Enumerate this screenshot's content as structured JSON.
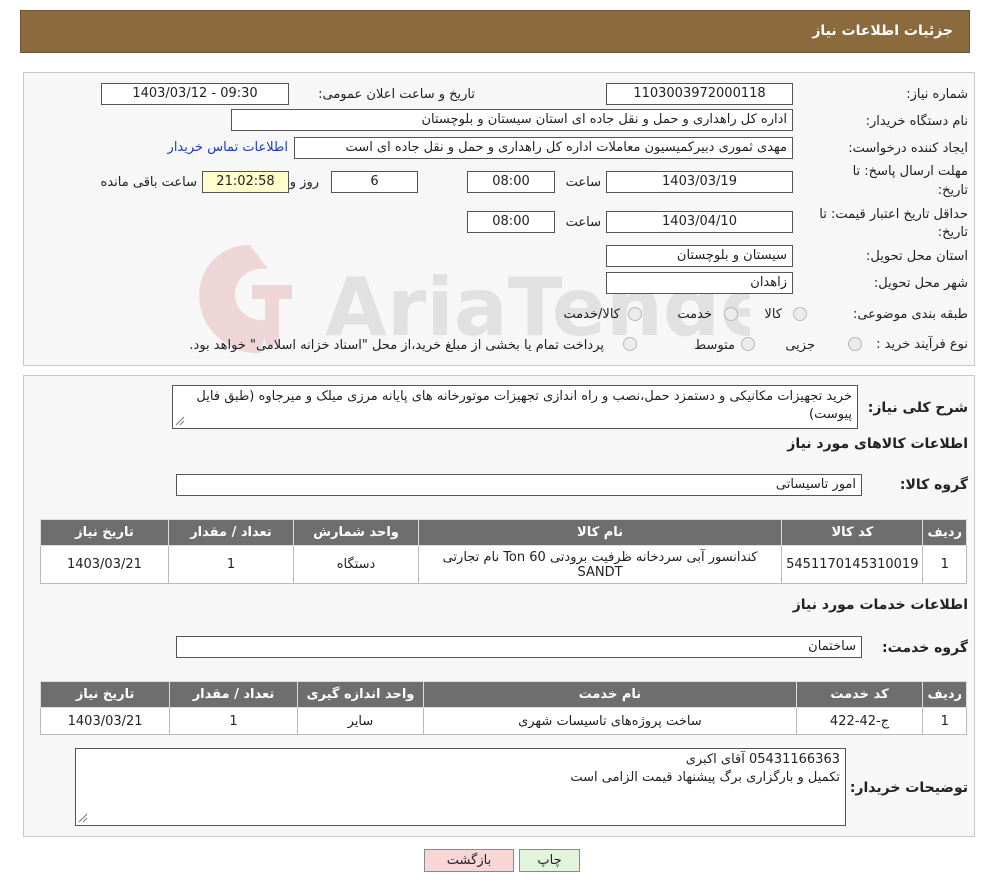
{
  "page": {
    "title": "جزئیات اطلاعات نیاز"
  },
  "watermark": {
    "text": "AriaTender.neT"
  },
  "info": {
    "need_number_label": "شماره نیاز:",
    "need_number": "1103003972000118",
    "announce_label": "تاریخ و ساعت اعلان عمومی:",
    "announce_value": "1403/03/12 - 09:30",
    "buyer_org_label": "نام دستگاه خریدار:",
    "buyer_org": "اداره کل راهداری و حمل و نقل جاده ای استان سیستان و بلوچستان",
    "creator_label": "ایجاد کننده درخواست:",
    "creator": "مهدی ثموری دبیرکمیسیون معاملات اداره کل راهداری و حمل و نقل جاده ای است",
    "contact_link": "اطلاعات تماس خریدار",
    "deadline_label_1": "مهلت ارسال پاسخ: تا",
    "deadline_label_2": "تاریخ:",
    "deadline_date": "1403/03/19",
    "time_label": "ساعت",
    "deadline_time": "08:00",
    "days_value": "6",
    "days_label": "روز و",
    "remaining_time": "21:02:58",
    "remaining_label": "ساعت باقی مانده",
    "validity_label_1": "حداقل تاریخ اعتبار قیمت: تا",
    "validity_label_2": "تاریخ:",
    "validity_date": "1403/04/10",
    "validity_time": "08:00",
    "province_label": "استان محل تحویل:",
    "province": "سیستان و بلوچستان",
    "city_label": "شهر محل تحویل:",
    "city": "زاهدان",
    "category_label": "طبقه بندی موضوعی:",
    "category_options": [
      "کالا",
      "خدمت",
      "کالا/خدمت"
    ],
    "process_label": "نوع فرآیند خرید :",
    "process_options": [
      "جزیی",
      "متوسط"
    ],
    "process_note": "پرداخت تمام یا بخشی از مبلغ خرید،از محل \"اسناد خزانه اسلامی\" خواهد بود."
  },
  "summary": {
    "label": "شرح کلی نیاز:",
    "text": "خرید تجهیزات مکانیکی و دستمزد حمل،نصب و راه اندازی تجهیزات موتورخانه های پایانه مرزی میلک و میرجاوه (طبق فایل پیوست)"
  },
  "goods": {
    "section_title": "اطلاعات کالاهای مورد نیاز",
    "group_label": "گروه کالا:",
    "group_value": "امور تاسیساتی",
    "headers": [
      "ردیف",
      "کد کالا",
      "نام کالا",
      "واحد شمارش",
      "تعداد / مقدار",
      "تاریخ نیاز"
    ],
    "rows": [
      [
        "1",
        "5451170145310019",
        "کندانسور آبی سردخانه ظرفیت برودتی Ton 60 نام تجارتی SANDT",
        "دستگاه",
        "1",
        "1403/03/21"
      ]
    ]
  },
  "services": {
    "section_title": "اطلاعات خدمات مورد نیاز",
    "group_label": "گروه خدمت:",
    "group_value": "ساختمان",
    "headers": [
      "ردیف",
      "کد خدمت",
      "نام خدمت",
      "واحد اندازه گیری",
      "تعداد / مقدار",
      "تاریخ نیاز"
    ],
    "rows": [
      [
        "1",
        "ج-42-422",
        "ساخت پروژه‌های تاسیسات شهری",
        "سایر",
        "1",
        "1403/03/21"
      ]
    ]
  },
  "buyer_notes": {
    "label": "توضیحات خریدار:",
    "line1": "05431166363 آقای اکبری",
    "line2": "تکمیل و بارگزاری برگ پیشنهاد قیمت الزامی است"
  },
  "buttons": {
    "print": "چاپ",
    "back": "بازگشت"
  },
  "colors": {
    "header_bg": "#8b6a3d",
    "table_header_bg": "#6e6e6e",
    "back_btn_bg": "#f8d6d6",
    "print_btn_bg": "#e3f4dc",
    "link": "#1a3eb8"
  }
}
